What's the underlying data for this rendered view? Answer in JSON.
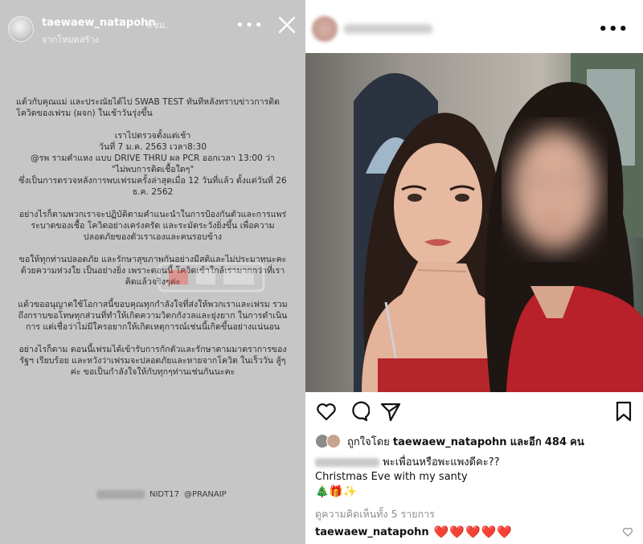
{
  "story": {
    "username": "taewaew_natapohn",
    "time": "6ชม.",
    "subtitle": "จากโหมดสร้าง",
    "more_icon": "more-icon",
    "close_icon": "close-icon",
    "paragraphs": [
      {
        "text": "แต้วกับคุณแม่ และประณัยได้ไป SWAB TEST ทันทีหลังทราบข่าวการติดโควิดของเฟรม (ผจก) ในเช้าวันรุ่งขึ้น",
        "align": "left"
      },
      {
        "text": "เราไปตรวจตั้งแต่เช้า\nวันที่ 7 ม.ค. 2563 เวลา8:30\n@รพ รามคำแหง แบบ DRIVE THRU ผล PCR ออกเวลา 13:00 ว่า\n\"ไม่พบการติดเชื้อใดๆ\"\nซึ่งเป็นการตรวจหลังการพบเฟรมครั้งล่าสุดเมื่อ 12 วันที่แล้ว ตั้งแต่วันที่ 26 ธ.ค. 2562",
        "align": "center"
      },
      {
        "text": "อย่างไรก็ตามพวกเราจะปฏิบัติตามคำแนะนำในการป้องกันตัวและการแพร่ระบาดของเชื้อ โควิดอย่างเคร่งครัด และระมัดระวังยิ่งขึ้น เพื่อความปลอดภัยของตัวเราเองและคนรอบข้าง",
        "align": "center"
      },
      {
        "text": "ขอให้ทุกท่านปลอดภัย และรักษาสุขภาพกันอย่างมีสติและไม่ประมาทนะคะ ด้วยความห่วงใย เป็นอย่างยิ่ง เพราะตอนนี้ โควิดเข้าใกล้เรามากกว่าที่เราคิดแล้วจริงๆค่ะ",
        "align": "center"
      },
      {
        "text": "แต้วขออนุญาตใช้โอกาสนี้ขอบคุณทุกกำลังใจที่ส่งให้พวกเราและเฟรม รวมถึงกราบขอโทษทุกส่วนที่ทำให้เกิดความวิตกกังวลและยุ่งยาก ในการดำเนินการ แต่เชื่อว่าไม่มีใครอยากให้เกิดเหตุการณ์เช่นนี้เกิดขึ้นอย่างแน่นอน",
        "align": "center"
      },
      {
        "text": "อย่างไรก็ตาม ตอนนี้เฟรมได้เข้ารับการกักตัวและรักษาตามมาตราการของรัฐฯ เรียบร้อย และหวังว่าเฟรมจะปลอดภัยและหายจากโควิด ในเร็ววัน สู้ๆค่ะ ขอเป็นกำลังใจให้กับทุกๆท่านเช่นกันนะคะ",
        "align": "center"
      }
    ],
    "tag_partial": "NIDT17",
    "tag_2": "@PRANAIP"
  },
  "post": {
    "more_icon": "more-icon",
    "actions": {
      "like": "heart-icon",
      "comment": "comment-icon",
      "share": "send-icon",
      "save": "bookmark-icon"
    },
    "likes_prefix": "ถูกใจโดย",
    "likes_user": "taewaew_natapohn",
    "likes_suffix_prefix": "และอีก",
    "likes_count": "484",
    "likes_suffix": "คน",
    "caption_text": "พะเพื่อนหรือพะแพงดีคะ??",
    "caption_line2": "Christmas Eve with my santy",
    "caption_emojis": "🎄🎁✨",
    "view_comments": "ดูความคิดเห็นทั้ง 5 รายการ",
    "comment_user": "taewaew_natapohn",
    "comment_text": "❤️❤️❤️❤️❤️"
  },
  "colors": {
    "story_bg": "#c6c6c6",
    "heart": "#e0245e",
    "muted": "#8e8e8e"
  }
}
